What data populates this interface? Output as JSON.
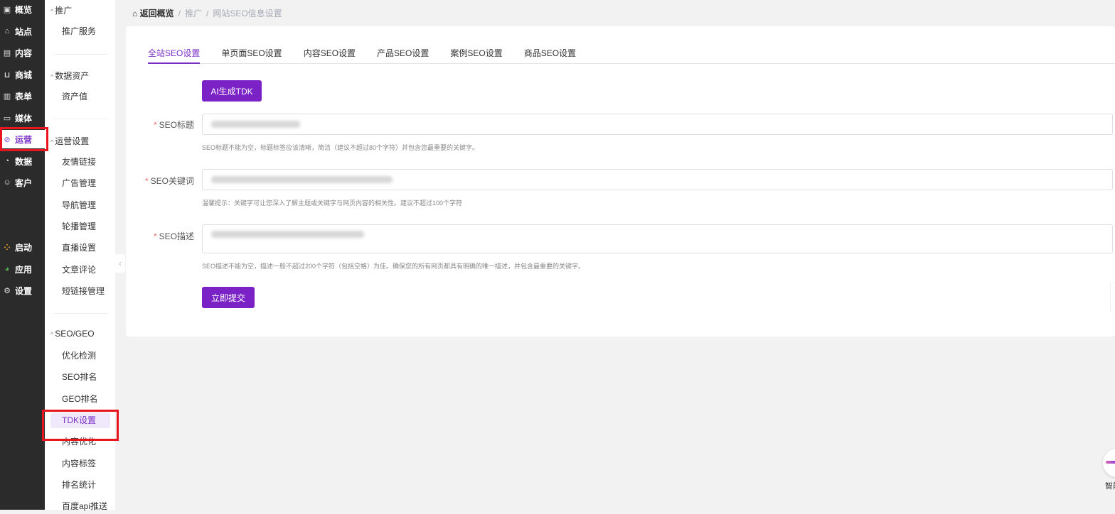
{
  "nav": [
    {
      "label": "概览",
      "icon": "monitor-icon"
    },
    {
      "label": "站点",
      "icon": "home-icon"
    },
    {
      "label": "内容",
      "icon": "document-icon"
    },
    {
      "label": "商城",
      "icon": "cart-icon"
    },
    {
      "label": "表单",
      "icon": "form-icon"
    },
    {
      "label": "媒体",
      "icon": "video-icon"
    },
    {
      "label": "运营",
      "icon": "paperclip-icon",
      "active": true
    },
    {
      "label": "数据",
      "icon": "clock-icon"
    },
    {
      "label": "客户",
      "icon": "user-icon"
    },
    {
      "label": "启动",
      "icon": "dots-icon"
    },
    {
      "label": "应用",
      "icon": "apps-icon"
    },
    {
      "label": "设置",
      "icon": "gear-icon"
    }
  ],
  "submenu": {
    "groups": [
      {
        "title": "推广",
        "items": [
          "推广服务"
        ]
      },
      {
        "title": "数据资产",
        "items": [
          "资产值"
        ]
      },
      {
        "title": "运营设置",
        "items": [
          "友情链接",
          "广告管理",
          "导航管理",
          "轮播管理",
          "直播设置",
          "文章评论",
          "短链接管理"
        ]
      },
      {
        "title": "SEO/GEO",
        "items": [
          "优化检测",
          "SEO排名",
          "GEO排名",
          "TDK设置",
          "内容优化",
          "内容标签",
          "排名统计",
          "百度api推送"
        ]
      }
    ],
    "active_item": "TDK设置"
  },
  "breadcrumb": [
    "返回概览",
    "推广",
    "网站SEO信息设置"
  ],
  "tabs": [
    "全站SEO设置",
    "单页面SEO设置",
    "内容SEO设置",
    "产品SEO设置",
    "案例SEO设置",
    "商品SEO设置"
  ],
  "active_tab": "全站SEO设置",
  "ai_button": "AI生成TDK",
  "form": {
    "title_label": "SEO标题",
    "title_hint": "SEO标题不能为空，标题标签应该清晰，简洁（建议不超过80个字符）并包含您最重要的关键字。",
    "keywords_label": "SEO关键词",
    "keywords_hint": "温馨提示：关键字可让您深入了解主题或关键字与网页内容的相关性。建议不超过100个字符",
    "desc_label": "SEO描述",
    "desc_hint": "SEO描述不能为空，描述一般不超过200个字符（包括空格）为佳。确保您的所有网页都具有明确的唯一描述，并包含最重要的关键字。",
    "required_mark": "*"
  },
  "submit_button": "立即提交",
  "assistant_label": "智能",
  "colors": {
    "accent": "#7b22c6",
    "sidebar": "#2b2b2b",
    "highlight": "#e8141e"
  }
}
